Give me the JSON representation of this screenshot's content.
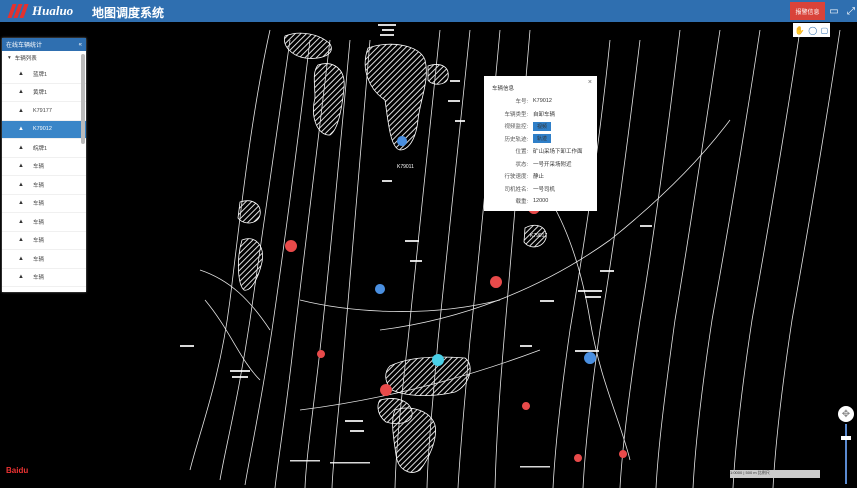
{
  "header": {
    "logo_text": "Hualuo",
    "title": "地图调度系统",
    "alarm_label": "报警信息",
    "alarm_color": "#d9433a",
    "brand_color": "#2f6fb0"
  },
  "sidebar": {
    "title": "在线车辆统计",
    "collapse_icon": "«",
    "group_label": "车辆列表",
    "items": [
      {
        "label": "蓝牌1"
      },
      {
        "label": "黄牌1"
      },
      {
        "label": "K79177"
      },
      {
        "label": "K79012",
        "active": true
      },
      {
        "label": "皖牌1"
      },
      {
        "label": "车辆"
      },
      {
        "label": "车辆"
      },
      {
        "label": "车辆"
      },
      {
        "label": "车辆"
      },
      {
        "label": "车辆"
      },
      {
        "label": "车辆"
      },
      {
        "label": "车辆"
      },
      {
        "label": "车辆"
      },
      {
        "label": "车辆"
      }
    ]
  },
  "popup": {
    "title": "车辆信息",
    "close": "×",
    "rows": [
      {
        "key": "车号:",
        "value": "K79012"
      },
      {
        "key": "车辆类型:",
        "value": "自卸车辆"
      },
      {
        "key": "视频监控:",
        "value": "视频",
        "button": true
      },
      {
        "key": "历史轨迹:",
        "value": "轨迹",
        "button": true
      },
      {
        "key": "位置:",
        "value": "矿山采场下卸工作面"
      },
      {
        "key": "状态:",
        "value": "一号开采场附近"
      },
      {
        "key": "行驶速度:",
        "value": "静止"
      },
      {
        "key": "司机姓名:",
        "value": "一号司机"
      },
      {
        "key": "载重:",
        "value": "12000"
      }
    ]
  },
  "map": {
    "labels": [
      {
        "text": "K79011"
      },
      {
        "text": "K79017"
      }
    ]
  },
  "footer": {
    "map_logo": "Baidu",
    "scale_text": "1:0000 | 500 m 比例尺"
  }
}
